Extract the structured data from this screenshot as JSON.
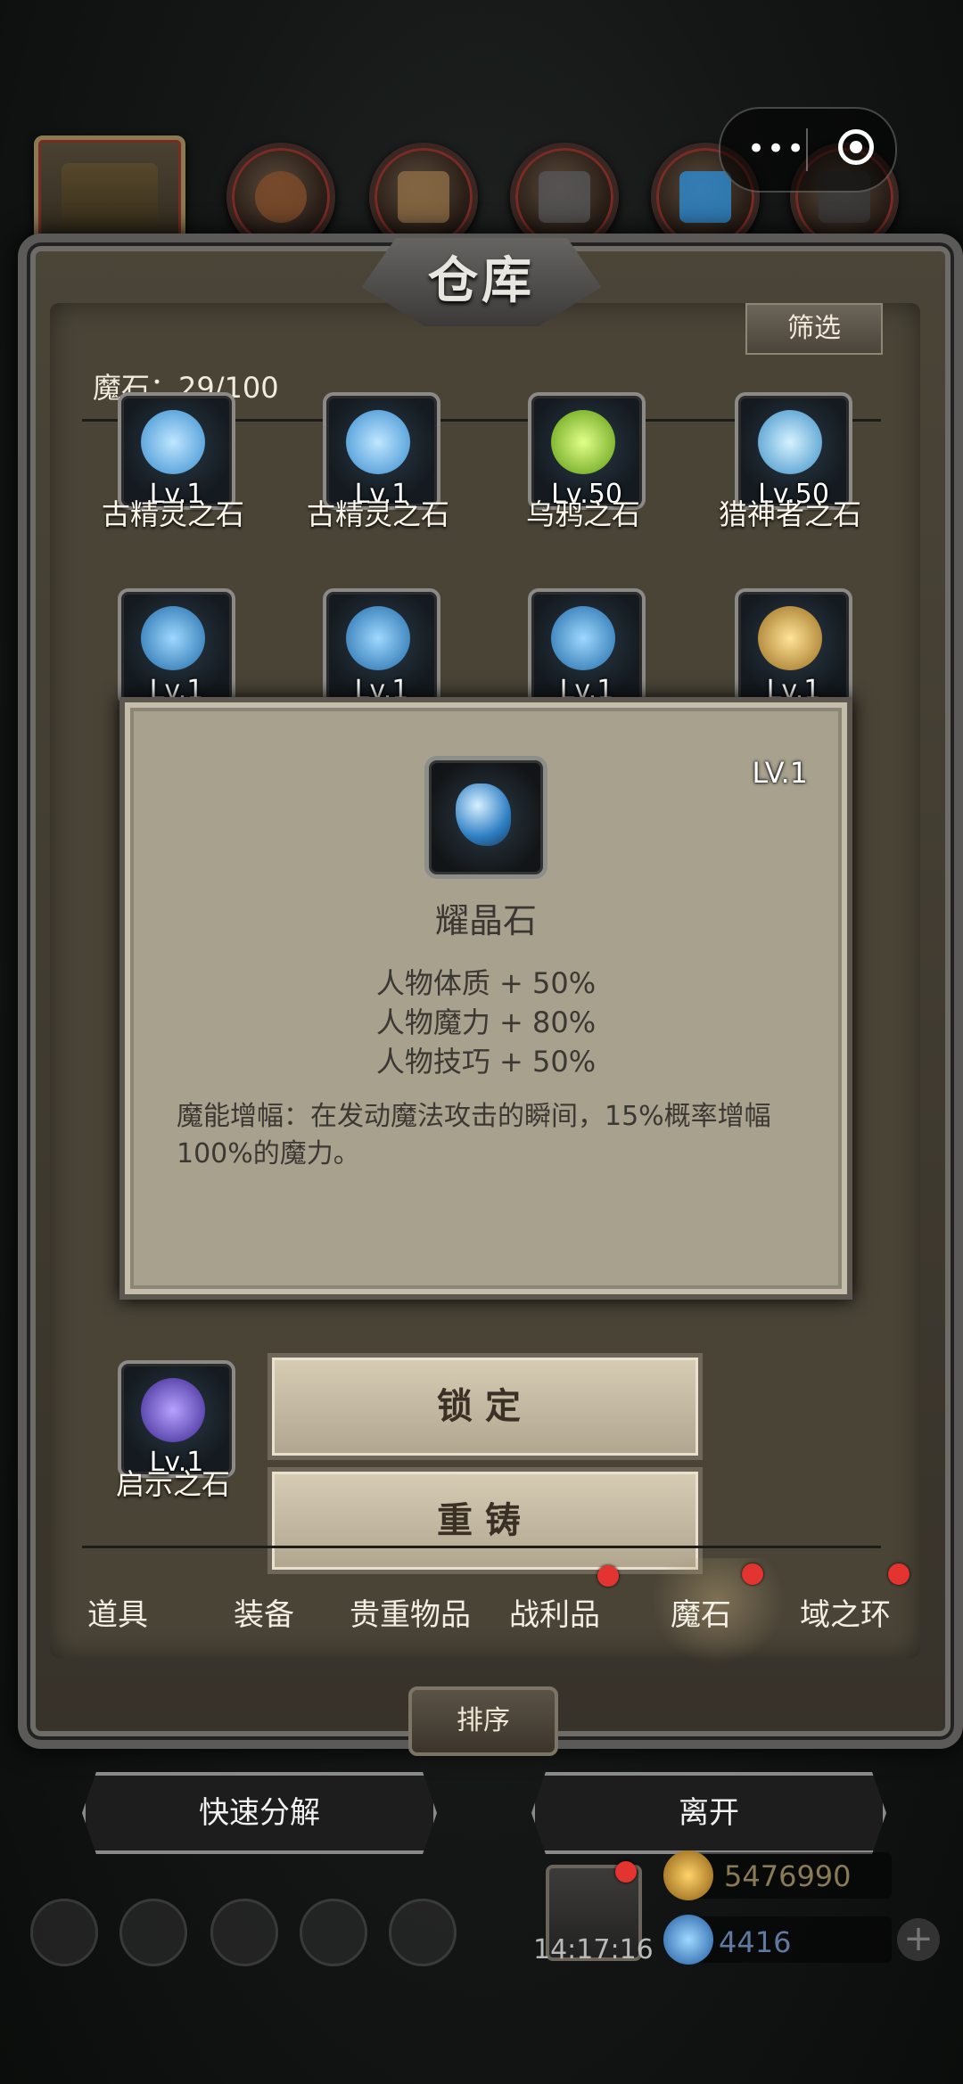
{
  "header": {
    "title": "仓库",
    "filter_label": "筛选",
    "count_label": "魔石：29/100"
  },
  "items_row1": [
    {
      "level": "Lv.1",
      "name": "古精灵之石",
      "color": "#5fb8f0"
    },
    {
      "level": "Lv.1",
      "name": "古精灵之石",
      "color": "#5fb8f0"
    },
    {
      "level": "Lv.50",
      "name": "乌鸦之石",
      "color": "#9ad22e"
    },
    {
      "level": "Lv.50",
      "name": "猎神者之石",
      "color": "#6cc6f2"
    }
  ],
  "items_row2": [
    {
      "level": "Lv.1",
      "color": "#49a6e0"
    },
    {
      "level": "Lv.1",
      "color": "#49a6e0"
    },
    {
      "level": "Lv.1",
      "color": "#49a6e0"
    },
    {
      "level": "Lv.1",
      "color": "#d9b046"
    }
  ],
  "item_row5": {
    "level": "Lv.1",
    "name": "启示之石",
    "color": "#6a4bd6"
  },
  "popup": {
    "level": "LV.1",
    "name": "耀晶石",
    "stats": [
      "人物体质 + 50%",
      "人物魔力 + 80%",
      "人物技巧 + 50%"
    ],
    "description": "魔能增幅：在发动魔法攻击的瞬间，15%概率增幅100%的魔力。"
  },
  "actions": {
    "lock": "锁定",
    "recast": "重铸"
  },
  "tabs": [
    "道具",
    "装备",
    "贵重物品",
    "战利品",
    "魔石",
    "域之环"
  ],
  "sort_label": "排序",
  "buttons": {
    "quick_decompose": "快速分解",
    "leave": "离开"
  },
  "footer": {
    "time": "14:17:16",
    "gold": "5476990",
    "gems": "4416"
  },
  "colors": {
    "accent_red": "#e3342f",
    "panel": "#4a4437",
    "popup": "#a8a18e"
  }
}
